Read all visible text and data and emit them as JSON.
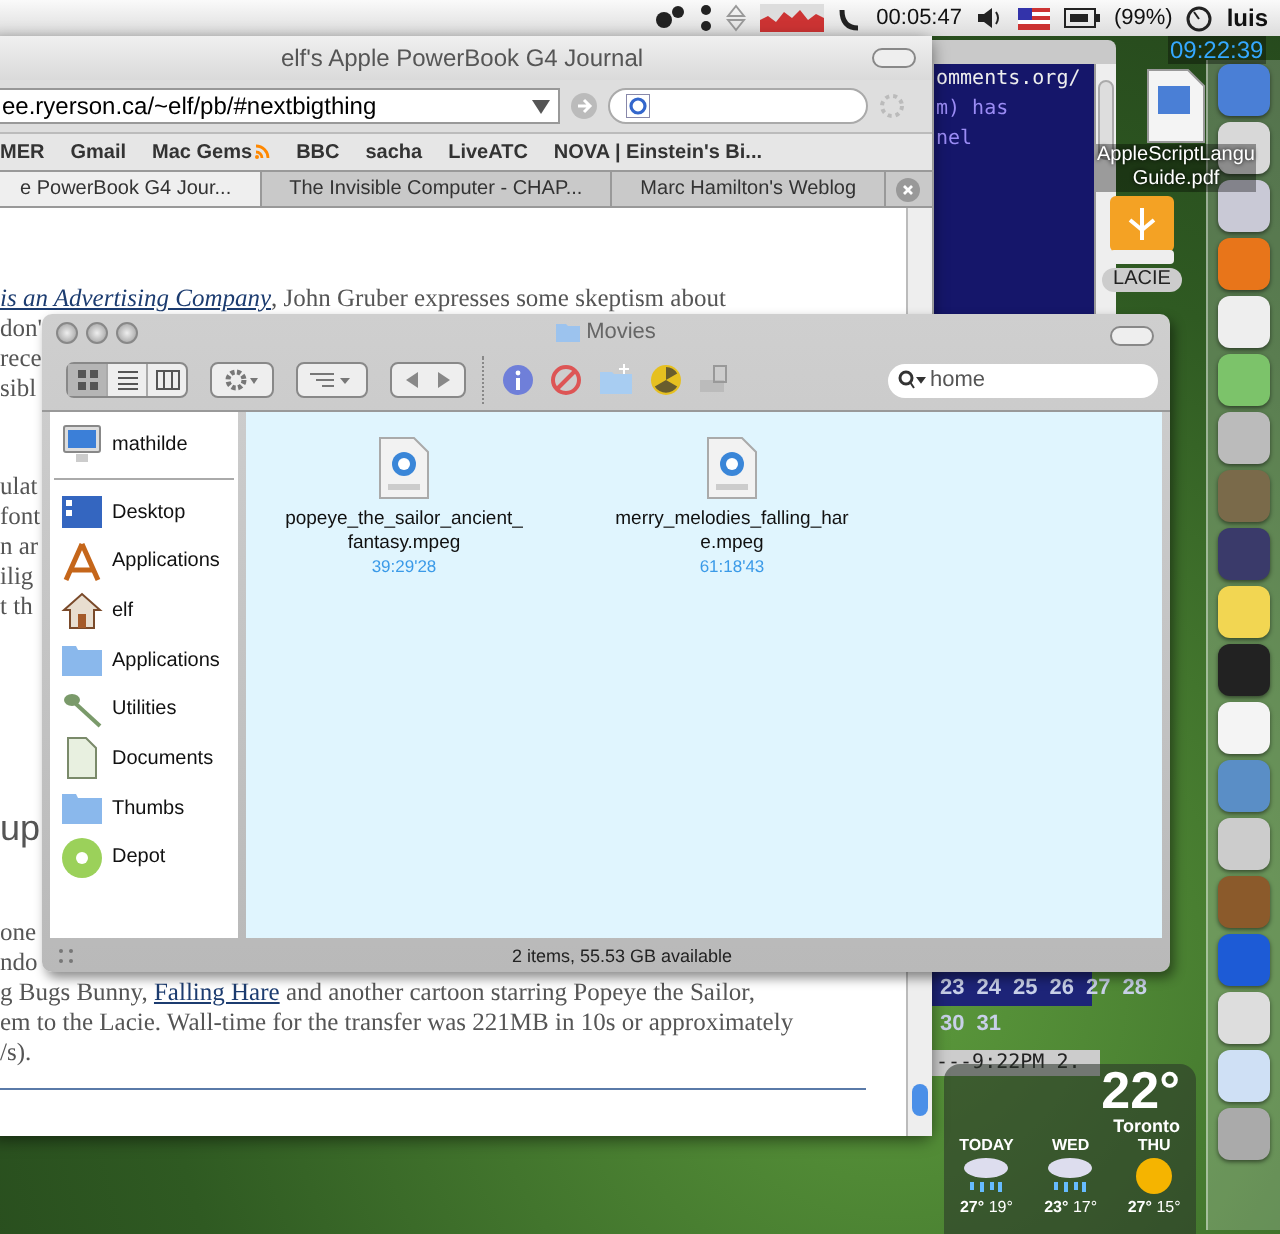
{
  "menubar": {
    "clock": "00:05:47",
    "battery": "(99%)",
    "user": "luis"
  },
  "desktop": {
    "clock": "09:22:39",
    "icons": [
      {
        "kind": "pdf",
        "label": "AppleScriptLangu Guide.pdf"
      },
      {
        "kind": "drive",
        "label": "LACIE"
      }
    ]
  },
  "terminal": {
    "lines": [
      "omments.org/",
      "m) has",
      "nel"
    ]
  },
  "calendar": {
    "rows": [
      [
        "23",
        "24",
        "25",
        "26",
        "27",
        "28"
      ],
      [
        "30",
        "31"
      ]
    ],
    "ticker": "---9:22PM 2."
  },
  "weather": {
    "temperature": "22°",
    "city": "Toronto",
    "days": [
      {
        "label": "TODAY",
        "kind": "rain",
        "high": "27°",
        "low": "19°"
      },
      {
        "label": "WED",
        "kind": "rain",
        "high": "23°",
        "low": "17°"
      },
      {
        "label": "THU",
        "kind": "sun",
        "high": "27°",
        "low": "15°"
      }
    ]
  },
  "browser": {
    "title": "elf's Apple PowerBook G4 Journal",
    "url": "ee.ryerson.ca/~elf/pb/#nextbigthing",
    "bookmarks": [
      {
        "label": "MER",
        "feed": false
      },
      {
        "label": "Gmail",
        "feed": false
      },
      {
        "label": "Mac Gems",
        "feed": true
      },
      {
        "label": "BBC",
        "feed": false
      },
      {
        "label": "sacha",
        "feed": false
      },
      {
        "label": "LiveATC",
        "feed": false
      },
      {
        "label": "NOVA | Einstein's Bi...",
        "feed": false
      }
    ],
    "tabs": [
      {
        "label": "e PowerBook G4 Jour...",
        "selected": true
      },
      {
        "label": "The Invisible Computer - CHAP...",
        "selected": false
      },
      {
        "label": "Marc Hamilton's Weblog",
        "selected": false
      }
    ],
    "blocks": [
      {
        "kind": "para",
        "lines": [
          [
            {
              "kind": "link",
              "text": "is an Advertising Company"
            },
            {
              "kind": "plain",
              "text": ", John Gruber expresses some skeptism about"
            }
          ],
          [
            {
              "kind": "plain",
              "text": "don'"
            }
          ],
          [
            {
              "kind": "plain",
              "text": "rece"
            }
          ],
          [
            {
              "kind": "plain",
              "text": "sibl"
            }
          ]
        ]
      },
      {
        "kind": "para",
        "lines": [
          [
            {
              "kind": "plain",
              "text": "ulat"
            }
          ],
          [
            {
              "kind": "plain",
              "text": "font"
            }
          ],
          [
            {
              "kind": "plain",
              "text": "n ar"
            }
          ],
          [
            {
              "kind": "plain",
              "text": "ilig"
            }
          ],
          [
            {
              "kind": "plain",
              "text": "t th"
            }
          ]
        ]
      },
      {
        "kind": "heading",
        "text": "up"
      },
      {
        "kind": "para",
        "lines": [
          [
            {
              "kind": "plain",
              "text": "one"
            }
          ],
          [
            {
              "kind": "plain",
              "text": "ndo"
            }
          ],
          [
            {
              "kind": "plain",
              "text": "g Bugs Bunny, "
            },
            {
              "kind": "link",
              "text": "Falling Hare"
            },
            {
              "kind": "plain",
              "text": " and another cartoon starring Popeye the Sailor,"
            }
          ],
          [
            {
              "kind": "plain",
              "text": "em to the Lacie. Wall-time for the transfer was 221MB in 10s or approximately"
            }
          ],
          [
            {
              "kind": "plain",
              "text": "/s)."
            }
          ]
        ]
      }
    ]
  },
  "finder": {
    "title": "Movies",
    "search": "home",
    "views": [
      {
        "kind": "icon",
        "selected": true
      },
      {
        "kind": "list",
        "selected": false
      },
      {
        "kind": "column",
        "selected": false
      }
    ],
    "sidebar": [
      {
        "label": "mathilde",
        "kind": "computer"
      },
      {
        "label": "Desktop",
        "kind": "desktop"
      },
      {
        "label": "Applications",
        "kind": "apps"
      },
      {
        "label": "elf",
        "kind": "home"
      },
      {
        "label": "Applications",
        "kind": "folder"
      },
      {
        "label": "Utilities",
        "kind": "utilities"
      },
      {
        "label": "Documents",
        "kind": "document"
      },
      {
        "label": "Thumbs",
        "kind": "folder"
      },
      {
        "label": "Depot",
        "kind": "disc"
      }
    ],
    "files": [
      {
        "name": "popeye_the_sailor_ancient_ fantasy.mpeg",
        "duration": "39:29'28"
      },
      {
        "name": "merry_melodies_falling_har e.mpeg",
        "duration": "61:18'43"
      }
    ],
    "status": "2 items, 55.53 GB available"
  }
}
